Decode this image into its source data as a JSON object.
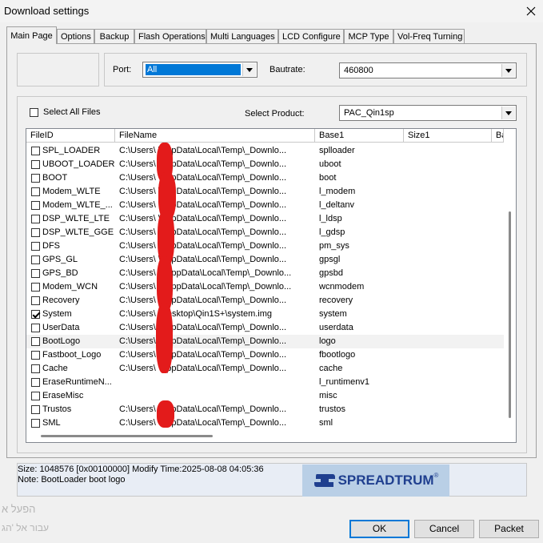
{
  "window": {
    "title": "Download settings"
  },
  "tabs": [
    {
      "label": "Main Page",
      "active": true
    },
    {
      "label": "Options"
    },
    {
      "label": "Backup"
    },
    {
      "label": "Flash Operations"
    },
    {
      "label": "Multi Languages"
    },
    {
      "label": "LCD Configure"
    },
    {
      "label": "MCP Type"
    },
    {
      "label": "Vol-Freq Turning"
    }
  ],
  "port": {
    "label": "Port:",
    "value": "All"
  },
  "baudrate": {
    "label": "Bautrate:",
    "value": "460800"
  },
  "select_all": {
    "label": "Select All Files",
    "checked": false
  },
  "product": {
    "label": "Select Product:",
    "value": "PAC_Qin1sp"
  },
  "table": {
    "columns": [
      "FileID",
      "FileName",
      "Base1",
      "Size1",
      "Ba"
    ],
    "rows": [
      {
        "id": "SPL_LOADER",
        "file": "C:\\Users\\    \\AppData\\Local\\Temp\\_Downlo...",
        "base": "splloader",
        "checked": false
      },
      {
        "id": "UBOOT_LOADER",
        "file": "C:\\Users\\    \\AppData\\Local\\Temp\\_Downlo...",
        "base": "uboot",
        "checked": false
      },
      {
        "id": "BOOT",
        "file": "C:\\Users\\    \\AppData\\Local\\Temp\\_Downlo...",
        "base": "boot",
        "checked": false
      },
      {
        "id": "Modem_WLTE",
        "file": "C:\\Users\\    \\AppData\\Local\\Temp\\_Downlo...",
        "base": "l_modem",
        "checked": false
      },
      {
        "id": "Modem_WLTE_...",
        "file": "C:\\Users\\    \\AppData\\Local\\Temp\\_Downlo...",
        "base": "l_deltanv",
        "checked": false
      },
      {
        "id": "DSP_WLTE_LTE",
        "file": "C:\\Users\\    \\AppData\\Local\\Temp\\_Downlo...",
        "base": "l_ldsp",
        "checked": false
      },
      {
        "id": "DSP_WLTE_GGE",
        "file": "C:\\Users\\    \\AppData\\Local\\Temp\\_Downlo...",
        "base": "l_gdsp",
        "checked": false
      },
      {
        "id": "DFS",
        "file": "C:\\Users\\    \\AppData\\Local\\Temp\\_Downlo...",
        "base": "pm_sys",
        "checked": false
      },
      {
        "id": "GPS_GL",
        "file": "C:\\Users\\    \\AppData\\Local\\Temp\\_Downlo...",
        "base": "gpsgl",
        "checked": false
      },
      {
        "id": "GPS_BD",
        "file": "C:\\Users\\    3\\AppData\\Local\\Temp\\_Downlo...",
        "base": "gpsbd",
        "checked": false
      },
      {
        "id": "Modem_WCN",
        "file": "C:\\Users\\    3\\AppData\\Local\\Temp\\_Downlo...",
        "base": "wcnmodem",
        "checked": false
      },
      {
        "id": "Recovery",
        "file": "C:\\Users\\    \\AppData\\Local\\Temp\\_Downlo...",
        "base": "recovery",
        "checked": false
      },
      {
        "id": "System",
        "file": "C:\\Users\\    \\Desktop\\Qin1S+\\system.img",
        "base": "system",
        "checked": true
      },
      {
        "id": "UserData",
        "file": "C:\\Users\\    \\AppData\\Local\\Temp\\_Downlo...",
        "base": "userdata",
        "checked": false
      },
      {
        "id": "BootLogo",
        "file": "C:\\Users\\    \\AppData\\Local\\Temp\\_Downlo...",
        "base": "logo",
        "checked": false,
        "selected": true
      },
      {
        "id": "Fastboot_Logo",
        "file": "C:\\Users\\    \\AppData\\Local\\Temp\\_Downlo...",
        "base": "fbootlogo",
        "checked": false
      },
      {
        "id": "Cache",
        "file": "C:\\Users\\    \\AppData\\Local\\Temp\\_Downlo...",
        "base": "cache",
        "checked": false
      },
      {
        "id": "EraseRuntimeN...",
        "file": "",
        "base": "l_runtimenv1",
        "checked": false
      },
      {
        "id": "EraseMisc",
        "file": "",
        "base": "misc",
        "checked": false
      },
      {
        "id": "Trustos",
        "file": "C:\\Users\\    \\AppData\\Local\\Temp\\_Downlo...",
        "base": "trustos",
        "checked": false
      },
      {
        "id": "SML",
        "file": "C:\\Users\\    \\AppData\\Local\\Temp\\_Downlo...",
        "base": "sml",
        "checked": false
      }
    ]
  },
  "status": {
    "line1": "Size: 1048576  [0x00100000] Modify Time:2025-08-08 04:05:36",
    "line2": "Note: BootLoader boot logo"
  },
  "logo": {
    "text": "SPREADTRUM",
    "mark": "®"
  },
  "background_text": [
    "הפעל א",
    "עבור אל 'הג"
  ],
  "buttons": {
    "ok": "OK",
    "cancel": "Cancel",
    "packet": "Packet"
  },
  "icons": {
    "close": "close-icon",
    "dropdown": "chevron-down-icon"
  },
  "colors": {
    "selection": "#0078d7",
    "redaction": "#e31b1b",
    "logo_bg": "#b9cfe6",
    "logo_text": "#1f3f8f"
  }
}
